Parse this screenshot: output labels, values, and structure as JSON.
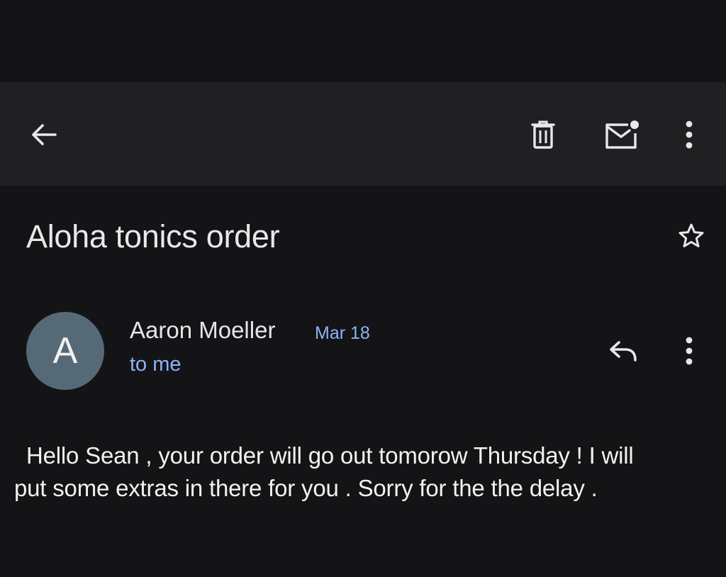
{
  "toolbar": {
    "back_icon": "arrow-left-icon",
    "delete_icon": "trash-icon",
    "mark_unread_icon": "mail-unread-icon",
    "more_icon": "more-vert-icon"
  },
  "email": {
    "subject": "Aloha tonics order",
    "star_icon": "star-outline-icon",
    "sender_initial": "A",
    "sender_name": "Aaron Moeller",
    "date": "Mar 18",
    "recipient": "to me",
    "reply_icon": "reply-icon",
    "more_icon": "more-vert-icon",
    "body_lines": [
      "Hello Sean , your order will go out tomorow Thursday ! I will",
      "put some extras in there for you . Sorry for the the delay ."
    ]
  },
  "colors": {
    "background": "#141416",
    "toolbar": "#202022",
    "accent_link": "#8ab4f8",
    "avatar": "#556a76"
  }
}
